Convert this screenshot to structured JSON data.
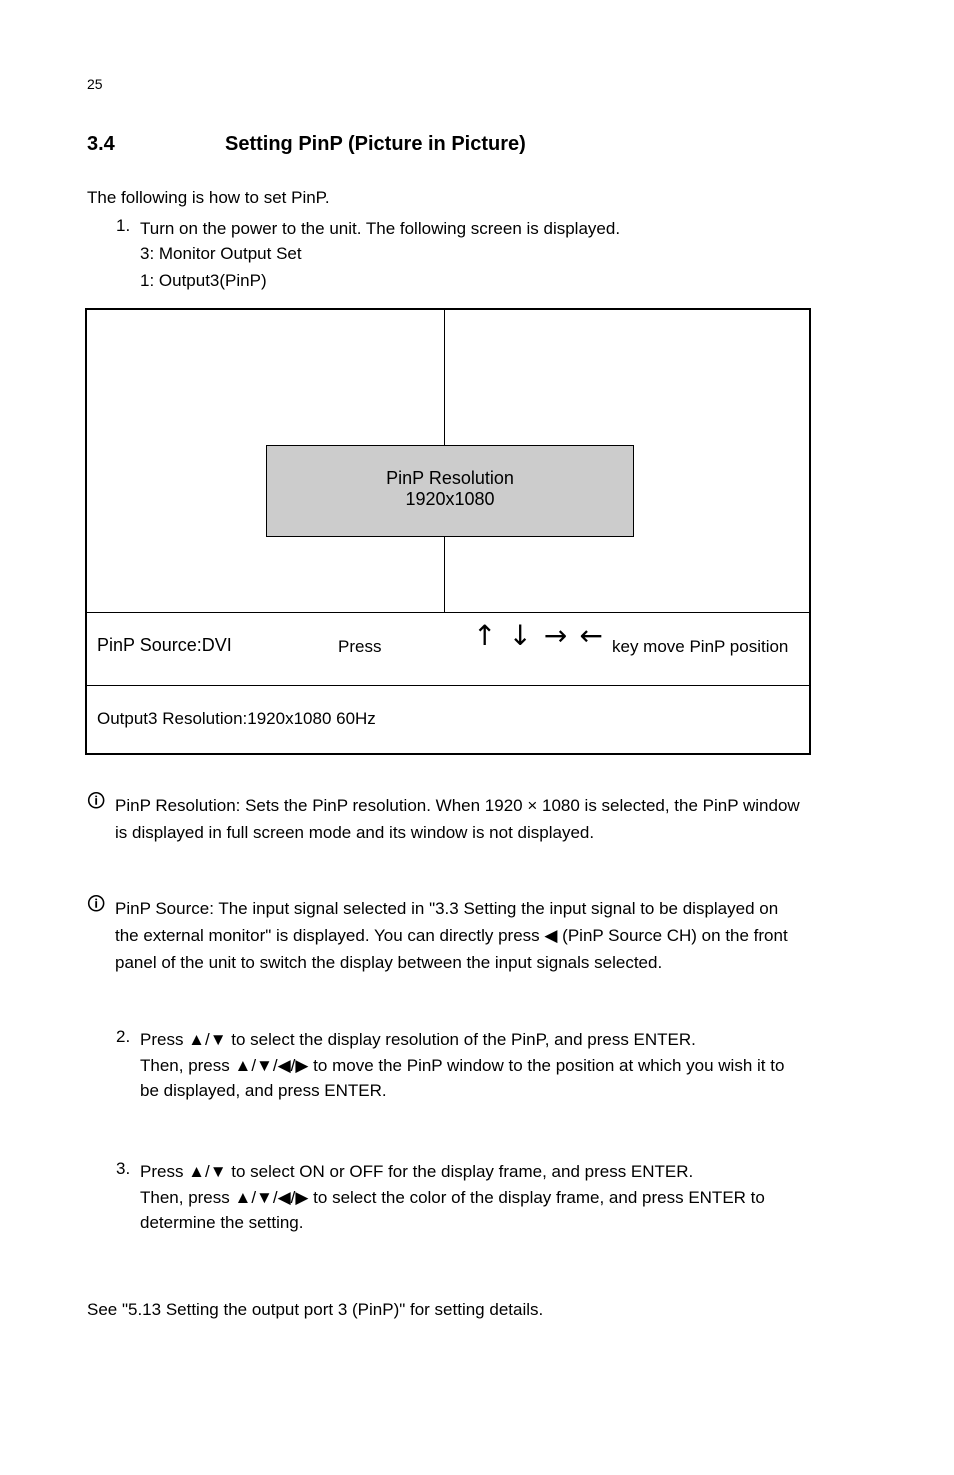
{
  "page_number": "25",
  "section": {
    "number": "3.4",
    "title": "Setting PinP (Picture in Picture)"
  },
  "intro": "The following is how to set PinP.",
  "steps": [
    {
      "num": "1.",
      "text": "Turn on the power to the unit. The following screen is displayed."
    },
    {
      "num": "2.",
      "text": "Press ▲/▼ to select the display resolution of the PinP, and press ENTER.\nThen, press ▲/▼/◀/▶ to move the PinP window to the position at which you wish it to\nbe displayed, and press ENTER."
    },
    {
      "num": "3.",
      "text": "Press ▲/▼ to select ON or OFF for the display frame, and press ENTER.\nThen, press ▲/▼/◀/▶ to select the color of the display frame, and press ENTER to\ndetermine the setting."
    }
  ],
  "key_labels": {
    "k1": "3: Monitor Output Set",
    "k2": "1: Output3(PinP)"
  },
  "screen": {
    "shaded_box": {
      "title": "PinP Resolution",
      "value": "1920x1080"
    },
    "status_row": {
      "source": "PinP Source:DVI",
      "press_label": "Press",
      "arrows_text": "↑↓→←",
      "move_label": "key move PinP position"
    },
    "bottom_status": "Output3 Resolution:1920x1080 60Hz"
  },
  "notes": [
    "PinP Resolution: Sets the PinP resolution. When 1920 × 1080 is selected, the PinP window\nis displayed in full screen mode and its window is not displayed.",
    "PinP Source: The input signal selected in \"3.3 Setting the input signal to be displayed on\nthe external monitor\" is displayed. You can directly press ◀ (PinP Source CH) on the front\npanel of the unit to switch the display between the input signals selected."
  ],
  "reference": "See \"5.13 Setting the output port 3 (PinP)\" for setting details."
}
